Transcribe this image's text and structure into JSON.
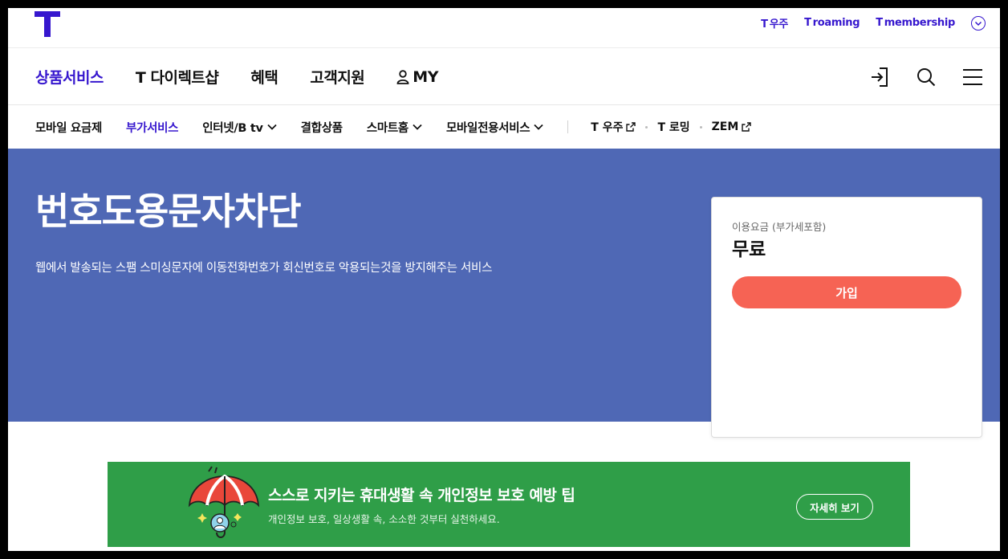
{
  "topbar": {
    "links": [
      {
        "prefix": "T",
        "label": "우주"
      },
      {
        "prefix": "T",
        "label": "roaming"
      },
      {
        "prefix": "T",
        "label": "membership"
      }
    ]
  },
  "gnb": {
    "items": [
      {
        "label": "상품서비스",
        "active": true
      },
      {
        "label": "T 다이렉트샵"
      },
      {
        "label": "혜택"
      },
      {
        "label": "고객지원"
      },
      {
        "label": "MY"
      }
    ],
    "icons": [
      "login-icon",
      "search-icon",
      "menu-icon"
    ]
  },
  "subnav": {
    "items": [
      {
        "label": "모바일 요금제"
      },
      {
        "label": "부가서비스",
        "active": true
      },
      {
        "label": "인터넷/B tv"
      },
      {
        "label": "결합상품"
      },
      {
        "label": "스마트홈"
      },
      {
        "label": "모바일전용서비스"
      }
    ],
    "external": [
      {
        "label": "T 우주"
      },
      {
        "label": "T 로밍"
      },
      {
        "label": "ZEM"
      }
    ]
  },
  "hero": {
    "title": "번호도용문자차단",
    "description": "웹에서 발송되는 스팸 스미싱문자에 이동전화번호가 회신번호로 악용되는것을 방지해주는 서비스"
  },
  "card": {
    "label": "이용요금 (부가세포함)",
    "price": "무료",
    "join_label": "가입"
  },
  "banner": {
    "title": "스스로 지키는 휴대생활 속 개인정보 보호 예방 팁",
    "subtitle": "개인정보 보호, 일상생활 속, 소소한 것부터 실천하세요.",
    "button_label": "자세히 보기"
  },
  "colors": {
    "brand": "#3617ce",
    "hero_bg": "#4f68b5",
    "join": "#f66354",
    "banner_bg": "#2f9e48"
  }
}
